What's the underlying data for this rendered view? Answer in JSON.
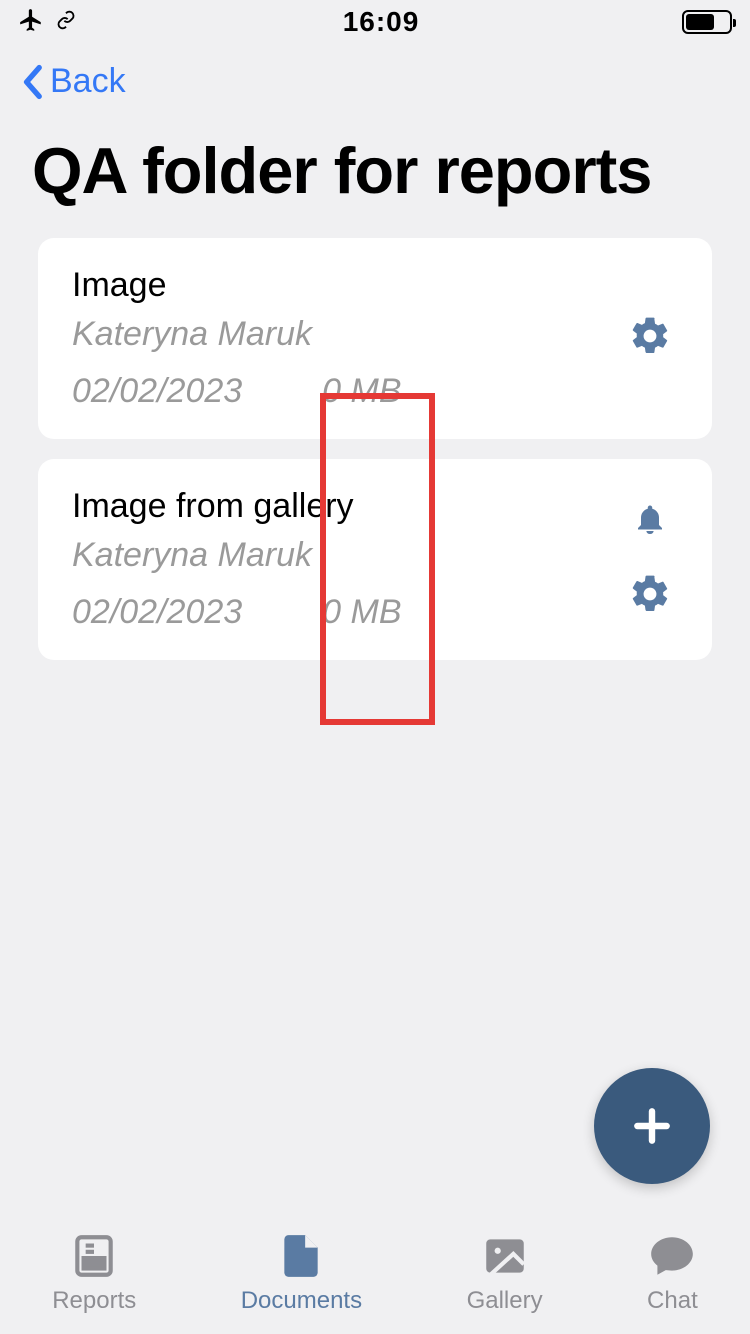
{
  "status": {
    "time": "16:09"
  },
  "nav": {
    "back_label": "Back"
  },
  "page": {
    "title": "QA  folder for reports"
  },
  "items": [
    {
      "title": "Image",
      "author": "Kateryna Maruk",
      "date": "02/02/2023",
      "size": "0 MB",
      "has_notification": false
    },
    {
      "title": "Image from gallery",
      "author": "Kateryna Maruk",
      "date": "02/02/2023",
      "size": "0 MB",
      "has_notification": true
    }
  ],
  "tabs": [
    {
      "label": "Reports",
      "active": false
    },
    {
      "label": "Documents",
      "active": true
    },
    {
      "label": "Gallery",
      "active": false
    },
    {
      "label": "Chat",
      "active": false
    }
  ]
}
